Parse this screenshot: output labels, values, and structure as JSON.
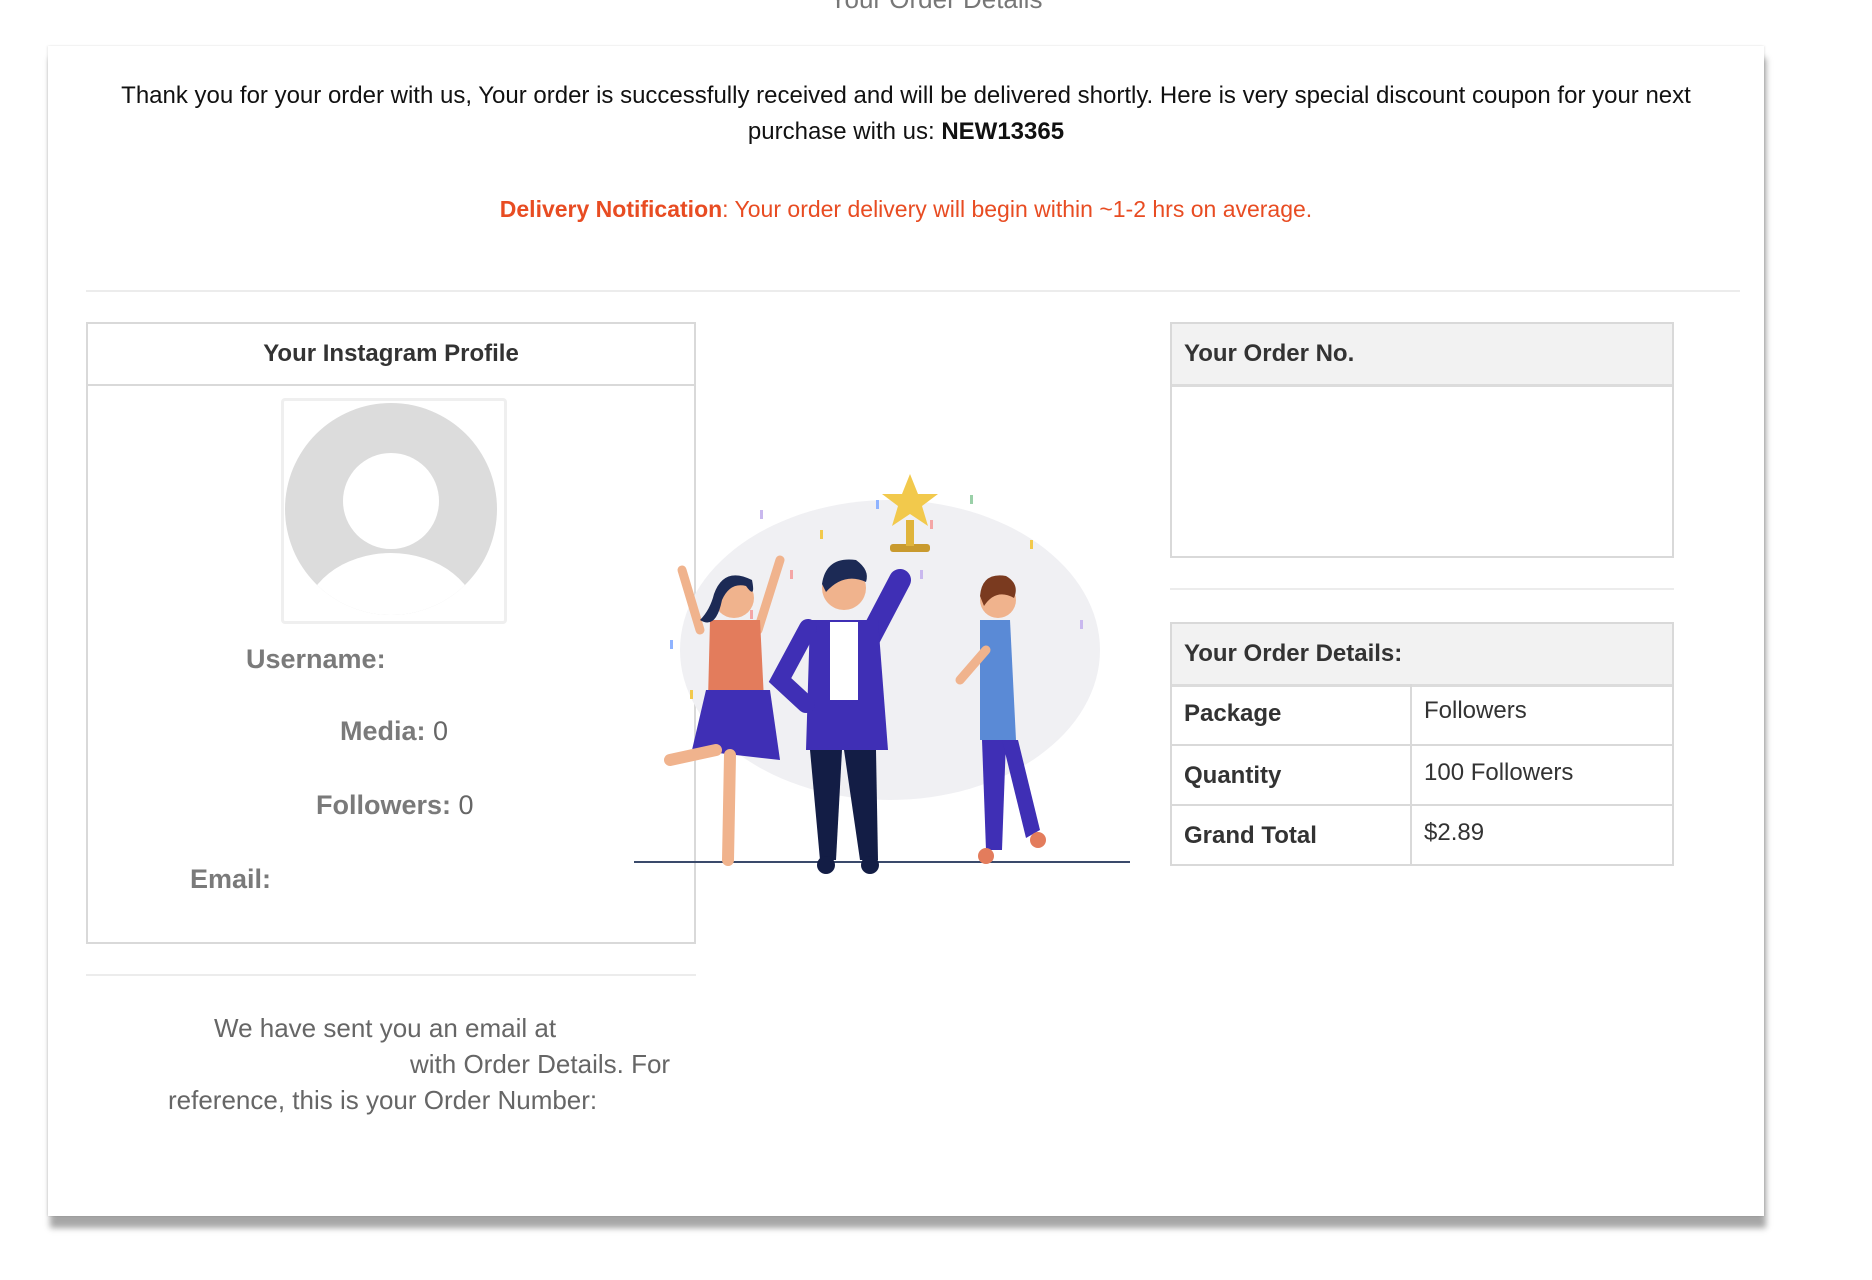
{
  "page": {
    "top_title": "Your Order Details"
  },
  "thanks": {
    "message": "Thank you for your order with us, Your order is successfully received and will be delivered shortly. Here is very special discount coupon for your next purchase with us: ",
    "coupon": "NEW13365"
  },
  "notification": {
    "label": "Delivery Notification",
    "text": ": Your order delivery will begin within ~1-2 hrs on average."
  },
  "profile": {
    "heading": "Your Instagram Profile",
    "username_label": "Username:",
    "username_value": "",
    "media_label": "Media:",
    "media_value": "0",
    "followers_label": "Followers:",
    "followers_value": "0",
    "email_label": "Email:",
    "email_value": ""
  },
  "email_notice": {
    "line1": "We have sent you an email at",
    "line2": "with Order Details. For",
    "line3": "reference, this is your Order Number:"
  },
  "order_no": {
    "heading": "Your Order No.",
    "value": ""
  },
  "order_details": {
    "heading": "Your Order Details:",
    "rows": [
      {
        "label": "Package",
        "value": "Followers"
      },
      {
        "label": "Quantity",
        "value": "100 Followers"
      },
      {
        "label": "Grand Total",
        "value": "$2.89"
      }
    ]
  },
  "colors": {
    "accent": "#e84c22",
    "border": "#d9d9d9",
    "header_bg": "#f2f2f2"
  },
  "icons": {
    "avatar": "default-avatar-icon",
    "illustration": "celebration-trophy-illustration"
  }
}
